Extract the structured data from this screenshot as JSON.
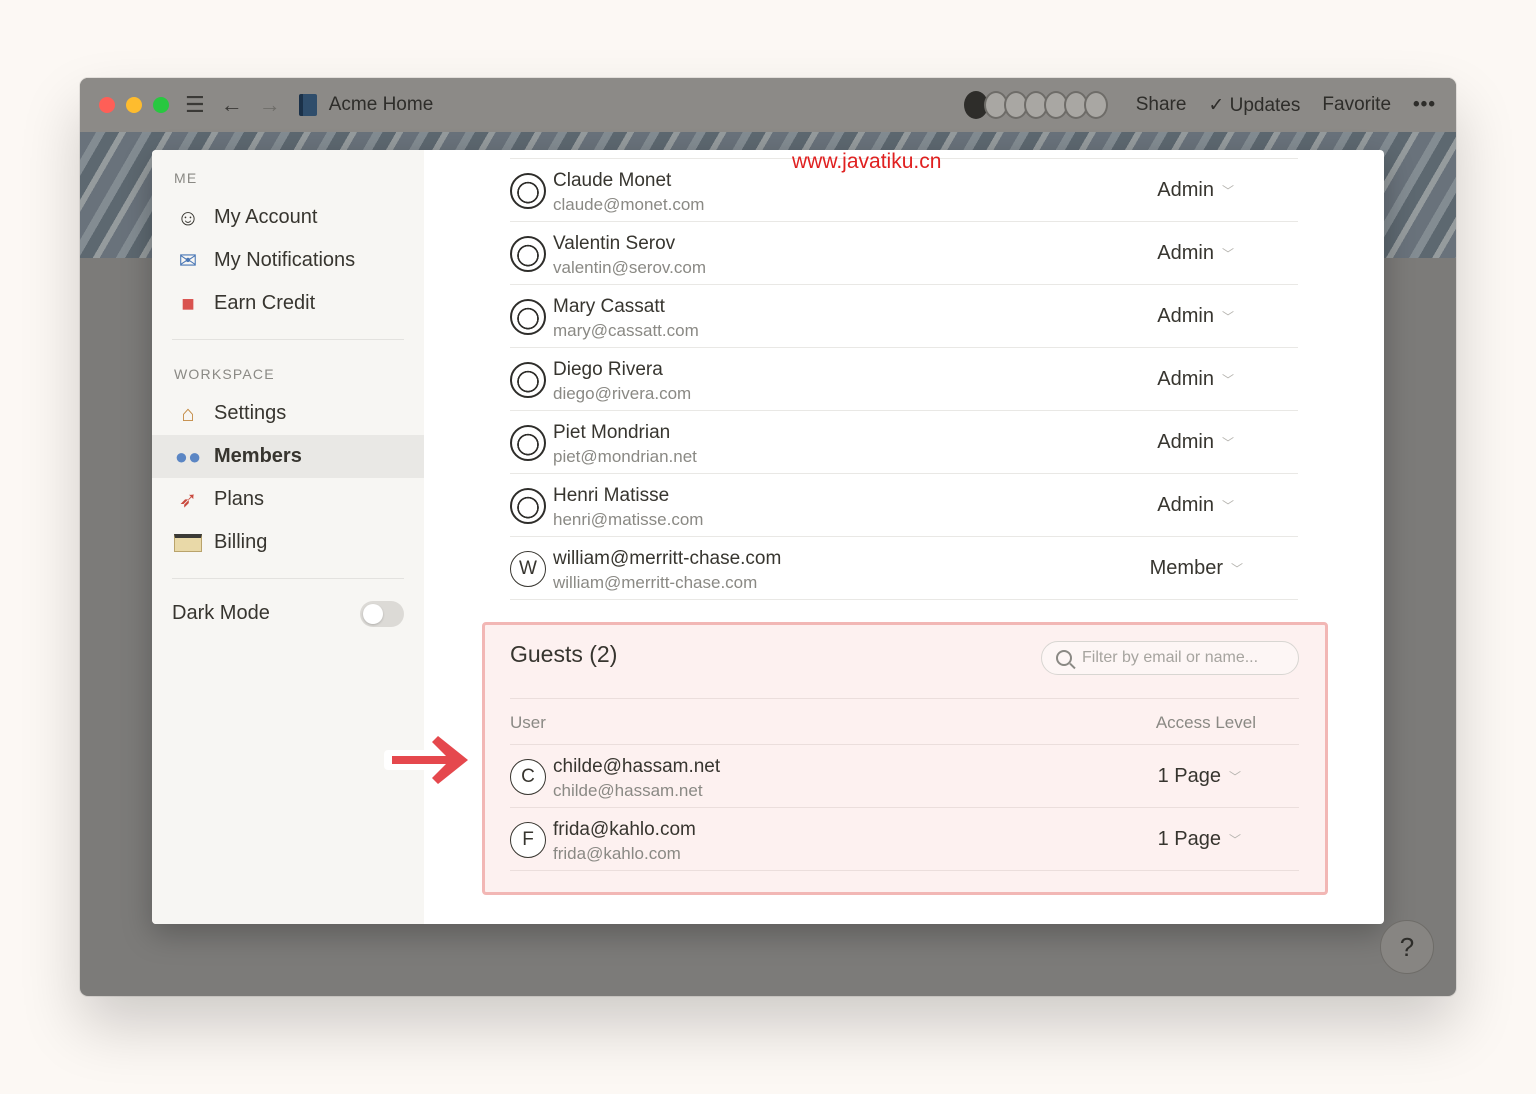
{
  "titlebar": {
    "title": "Acme Home",
    "share_label": "Share",
    "updates_label": "Updates",
    "favorite_label": "Favorite",
    "more_label": "•••",
    "traffic_colors": [
      "#fe5f57",
      "#febc2e",
      "#28c840"
    ]
  },
  "sidebar": {
    "me_section": "ME",
    "me_items": [
      {
        "label": "My Account",
        "icon": "user-face-icon"
      },
      {
        "label": "My Notifications",
        "icon": "mailbox-icon"
      },
      {
        "label": "Earn Credit",
        "icon": "gift-icon"
      }
    ],
    "workspace_section": "WORKSPACE",
    "workspace_items": [
      {
        "label": "Settings",
        "icon": "house-icon"
      },
      {
        "label": "Members",
        "icon": "people-icon"
      },
      {
        "label": "Plans",
        "icon": "rocket-icon"
      },
      {
        "label": "Billing",
        "icon": "credit-card-icon"
      }
    ],
    "dark_mode_label": "Dark Mode"
  },
  "members": [
    {
      "name": "Claude Monet",
      "email": "claude@monet.com",
      "role": "Admin",
      "avatar": "face"
    },
    {
      "name": "Valentin Serov",
      "email": "valentin@serov.com",
      "role": "Admin",
      "avatar": "face"
    },
    {
      "name": "Mary Cassatt",
      "email": "mary@cassatt.com",
      "role": "Admin",
      "avatar": "face"
    },
    {
      "name": "Diego Rivera",
      "email": "diego@rivera.com",
      "role": "Admin",
      "avatar": "face"
    },
    {
      "name": "Piet Mondrian",
      "email": "piet@mondrian.net",
      "role": "Admin",
      "avatar": "face"
    },
    {
      "name": "Henri Matisse",
      "email": "henri@matisse.com",
      "role": "Admin",
      "avatar": "face"
    },
    {
      "name": "william@merritt-chase.com",
      "email": "william@merritt-chase.com",
      "role": "Member",
      "avatar": "W"
    }
  ],
  "guests": {
    "title": "Guests (2)",
    "filter_placeholder": "Filter by email or name...",
    "col_user": "User",
    "col_access": "Access Level",
    "rows": [
      {
        "name": "childe@hassam.net",
        "email": "childe@hassam.net",
        "access": "1 Page",
        "avatar": "C"
      },
      {
        "name": "frida@kahlo.com",
        "email": "frida@kahlo.com",
        "access": "1 Page",
        "avatar": "F"
      }
    ]
  },
  "watermark": "www.javatiku.cn",
  "help_label": "?"
}
